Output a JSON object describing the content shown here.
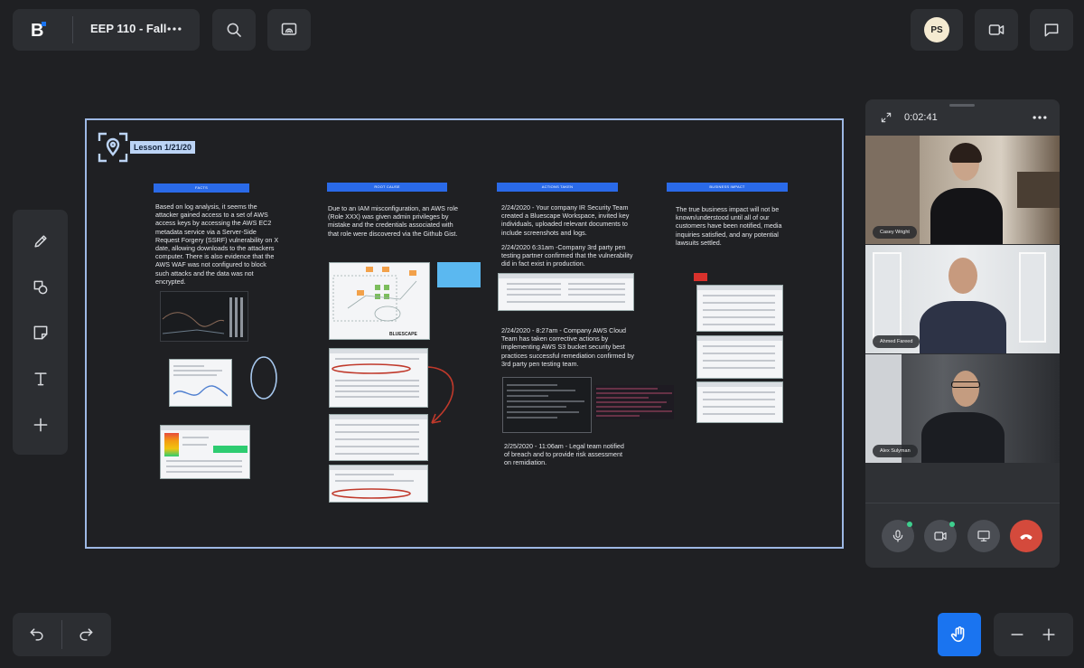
{
  "header": {
    "logo_letter": "B",
    "workspace_title": "EEP 110 - Fall",
    "avatar_initials": "PS",
    "icons": [
      "bluescape-logo-icon",
      "more-horizontal-icon",
      "search-icon",
      "screen-share-icon",
      "video-camera-icon",
      "chat-icon"
    ]
  },
  "toolbar": {
    "tools": [
      {
        "name": "pencil-icon"
      },
      {
        "name": "shapes-icon"
      },
      {
        "name": "sticky-note-icon"
      },
      {
        "name": "text-icon",
        "glyph": "T"
      },
      {
        "name": "add-icon",
        "glyph": "+"
      }
    ]
  },
  "board": {
    "frame_label": "Lesson 1/21/20",
    "columns": [
      {
        "heading": "FACTS",
        "text": "Based on log analysis, it seems the attacker gained access to a set of AWS access keys by accessing the AWS EC2 metadata service via a Server-Side Request Forgery (SSRF) vulnerability on X date, allowing downloads to the attackers computer. There is also evidence that the AWS WAF was not configured to block such attacks and the data was not encrypted."
      },
      {
        "heading": "ROOT CAUSE",
        "text": "Due to an IAM misconfiguration, an AWS role (Role XXX) was given admin privileges by mistake and the credentials associated with that role were discovered via the Github Gist."
      },
      {
        "heading": "ACTIONS TAKEN",
        "entries": [
          "2/24/2020 - Your company IR Security Team created a Bluescape Workspace, invited key individuals, uploaded relevant documents to include screenshots and logs.",
          "2/24/2020 6:31am -Company 3rd party pen testing partner confirmed that the vulnerability did in fact exist in production.",
          "2/24/2020 - 8:27am - Company AWS Cloud Team has taken corrective actions by implementing AWS S3 bucket security best practices successful remediation confirmed by 3rd party pen testing team.",
          "2/25/2020 - 11:06am - Legal team notified of breach and to provide risk assessment on remidiation."
        ]
      },
      {
        "heading": "BUSINESS IMPACT",
        "text": "The true business impact will not be known/understood until all of our customers have been notified, media inquiries satisfied, and any potential lawsuits settled."
      }
    ],
    "diagram_watermark": "BLUESCAPE"
  },
  "call": {
    "elapsed": "0:02:41",
    "participants": [
      {
        "name": "Casey Wright"
      },
      {
        "name": "Ahmed Fareed"
      },
      {
        "name": "Alex Sulyman"
      }
    ],
    "controls": [
      "microphone-icon",
      "camera-icon",
      "screen-icon",
      "end-call-icon"
    ],
    "colors": {
      "end_call": "#d44a3c",
      "active_dot": "#3ecf8e"
    }
  },
  "footer": {
    "icons": [
      "undo-icon",
      "redo-icon",
      "hand-icon",
      "zoom-out-icon",
      "zoom-in-icon"
    ],
    "zoom_out": "−",
    "zoom_in": "+"
  },
  "colors": {
    "accent": "#1a74f0",
    "background": "#1f2023",
    "panel": "#2c2e32",
    "frame": "#9db8e4",
    "heading": "#2a6ae8"
  }
}
